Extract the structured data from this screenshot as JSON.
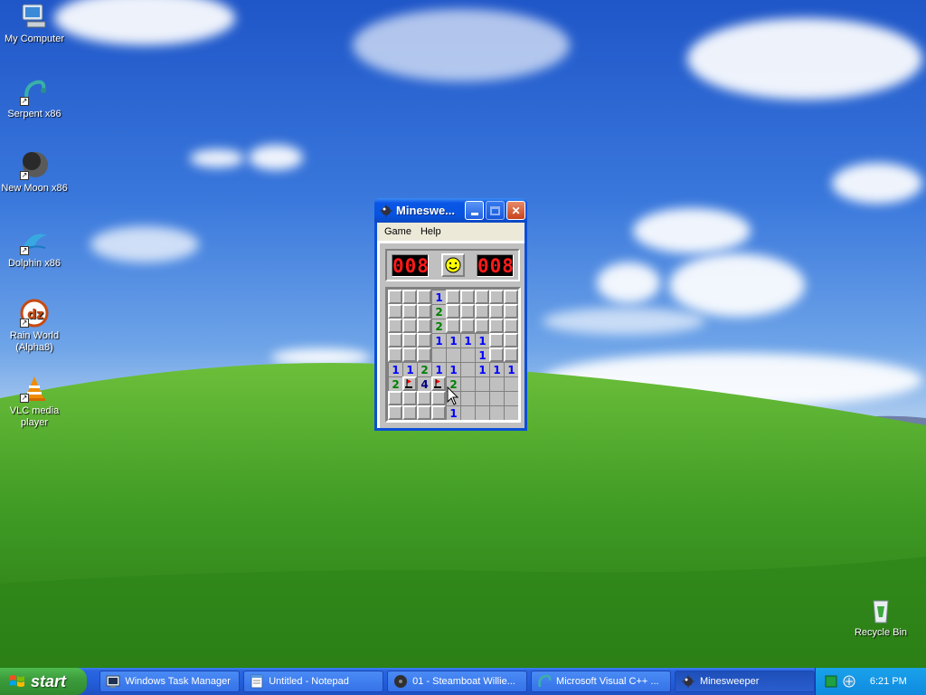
{
  "desktop_icons": [
    {
      "label": "My Computer",
      "icon": "computer-icon"
    },
    {
      "label": "Serpent x86",
      "icon": "serpent-icon"
    },
    {
      "label": "New Moon x86",
      "icon": "moon-icon"
    },
    {
      "label": "Dolphin x86",
      "icon": "dolphin-icon"
    },
    {
      "label": "Rain World (Alpha8)",
      "icon": "rainworld-icon"
    },
    {
      "label": "VLC media player",
      "icon": "vlc-cone-icon"
    },
    {
      "label": "Recycle Bin",
      "icon": "recycle-bin-icon"
    }
  ],
  "minesweeper": {
    "title": "Mineswe...",
    "menu": [
      "Game",
      "Help"
    ],
    "mine_counter": "008",
    "timer": "008",
    "face": "smiley-face-icon",
    "grid": [
      [
        "c",
        "c",
        "c",
        "1",
        "c",
        "c",
        "c",
        "c",
        "c"
      ],
      [
        "c",
        "c",
        "c",
        "2",
        "c",
        "c",
        "c",
        "c",
        "c"
      ],
      [
        "c",
        "c",
        "c",
        "2",
        "c",
        "c",
        "c",
        "c",
        "c"
      ],
      [
        "c",
        "c",
        "c",
        "1",
        "1",
        "1",
        "1",
        "c",
        "c"
      ],
      [
        "c",
        "c",
        "c",
        "",
        "",
        "",
        "1",
        "c",
        "c"
      ],
      [
        "1",
        "1",
        "2",
        "1",
        "1",
        "",
        "1",
        "1",
        "1"
      ],
      [
        "2",
        "F",
        "4",
        "F",
        "2",
        "",
        "",
        "",
        ""
      ],
      [
        "c",
        "c",
        "c",
        "c",
        "",
        "",
        "",
        "",
        ""
      ],
      [
        "c",
        "c",
        "c",
        "c",
        "1",
        "",
        "",
        "",
        ""
      ]
    ]
  },
  "taskbar": {
    "start_label": "start",
    "tasks": [
      {
        "label": "Windows Task Manager",
        "icon": "task-manager-icon"
      },
      {
        "label": "Untitled - Notepad",
        "icon": "notepad-icon"
      },
      {
        "label": "01 - Steamboat Willie...",
        "icon": "media-icon"
      },
      {
        "label": "Microsoft Visual C++ ...",
        "icon": "visual-cpp-icon"
      },
      {
        "label": "Minesweeper",
        "icon": "minesweeper-icon",
        "active": true
      }
    ],
    "clock": "6:21 PM"
  },
  "colors": {
    "taskbar_blue": "#245edb",
    "start_green": "#3d9d3d",
    "led_red": "#ff1a1a",
    "title_blue": "#0654e0"
  }
}
